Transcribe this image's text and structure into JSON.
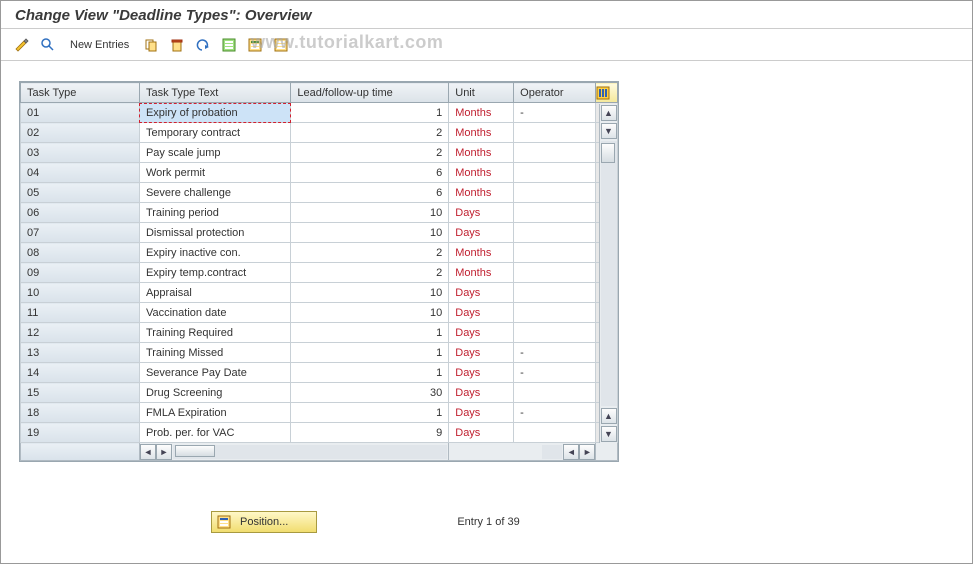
{
  "title": "Change View \"Deadline Types\": Overview",
  "toolbar": {
    "new_entries": "New Entries"
  },
  "watermark": "www.tutorialkart.com",
  "columns": {
    "task_type": "Task Type",
    "task_type_text": "Task Type Text",
    "lead_time": "Lead/follow-up time",
    "unit": "Unit",
    "operator": "Operator"
  },
  "rows": [
    {
      "type": "01",
      "text": "Expiry of probation",
      "lead": "1",
      "unit": "Months",
      "op": "-",
      "selected": true
    },
    {
      "type": "02",
      "text": "Temporary contract",
      "lead": "2",
      "unit": "Months",
      "op": ""
    },
    {
      "type": "03",
      "text": "Pay scale jump",
      "lead": "2",
      "unit": "Months",
      "op": ""
    },
    {
      "type": "04",
      "text": "Work permit",
      "lead": "6",
      "unit": "Months",
      "op": ""
    },
    {
      "type": "05",
      "text": "Severe challenge",
      "lead": "6",
      "unit": "Months",
      "op": ""
    },
    {
      "type": "06",
      "text": "Training period",
      "lead": "10",
      "unit": "Days",
      "op": ""
    },
    {
      "type": "07",
      "text": "Dismissal protection",
      "lead": "10",
      "unit": "Days",
      "op": ""
    },
    {
      "type": "08",
      "text": "Expiry inactive con.",
      "lead": "2",
      "unit": "Months",
      "op": ""
    },
    {
      "type": "09",
      "text": "Expiry temp.contract",
      "lead": "2",
      "unit": "Months",
      "op": ""
    },
    {
      "type": "10",
      "text": "Appraisal",
      "lead": "10",
      "unit": "Days",
      "op": ""
    },
    {
      "type": "11",
      "text": "Vaccination date",
      "lead": "10",
      "unit": "Days",
      "op": ""
    },
    {
      "type": "12",
      "text": "Training Required",
      "lead": "1",
      "unit": "Days",
      "op": ""
    },
    {
      "type": "13",
      "text": "Training Missed",
      "lead": "1",
      "unit": "Days",
      "op": "-"
    },
    {
      "type": "14",
      "text": "Severance Pay Date",
      "lead": "1",
      "unit": "Days",
      "op": "-"
    },
    {
      "type": "15",
      "text": "Drug Screening",
      "lead": "30",
      "unit": "Days",
      "op": ""
    },
    {
      "type": "18",
      "text": "FMLA Expiration",
      "lead": "1",
      "unit": "Days",
      "op": "-"
    },
    {
      "type": "19",
      "text": "Prob. per. for VAC",
      "lead": "9",
      "unit": "Days",
      "op": ""
    }
  ],
  "footer": {
    "position_label": "Position...",
    "entry_text": "Entry 1 of 39"
  }
}
